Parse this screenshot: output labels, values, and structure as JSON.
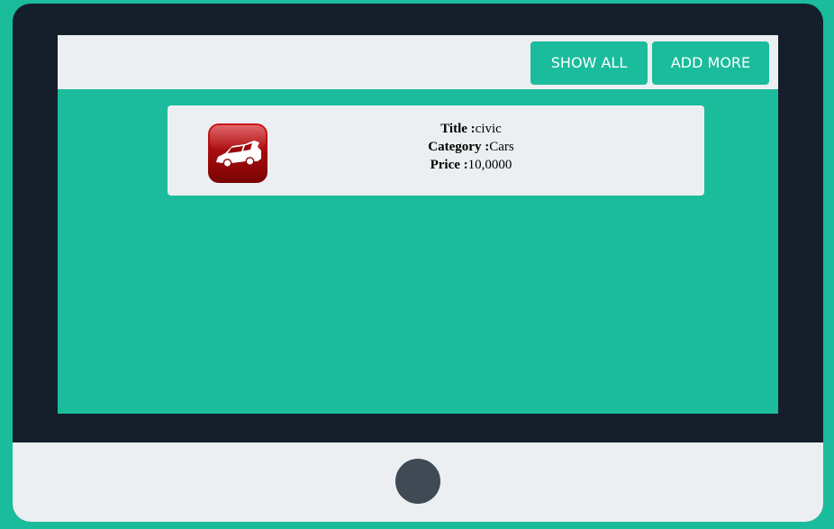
{
  "nav": {
    "show_all_label": "SHOW ALL",
    "add_more_label": "ADD MORE"
  },
  "listing": {
    "image_icon": "car-icon",
    "title_label": "Title :",
    "title_value": "civic",
    "category_label": "Category :",
    "category_value": "Cars",
    "price_label": "Price :",
    "price_value": "10,0000"
  },
  "colors": {
    "accent": "#1abc9c",
    "frame": "#141f2b",
    "panel": "#eceff1",
    "home_button": "#3f4a54",
    "car_icon_red": "#b30b0b"
  }
}
